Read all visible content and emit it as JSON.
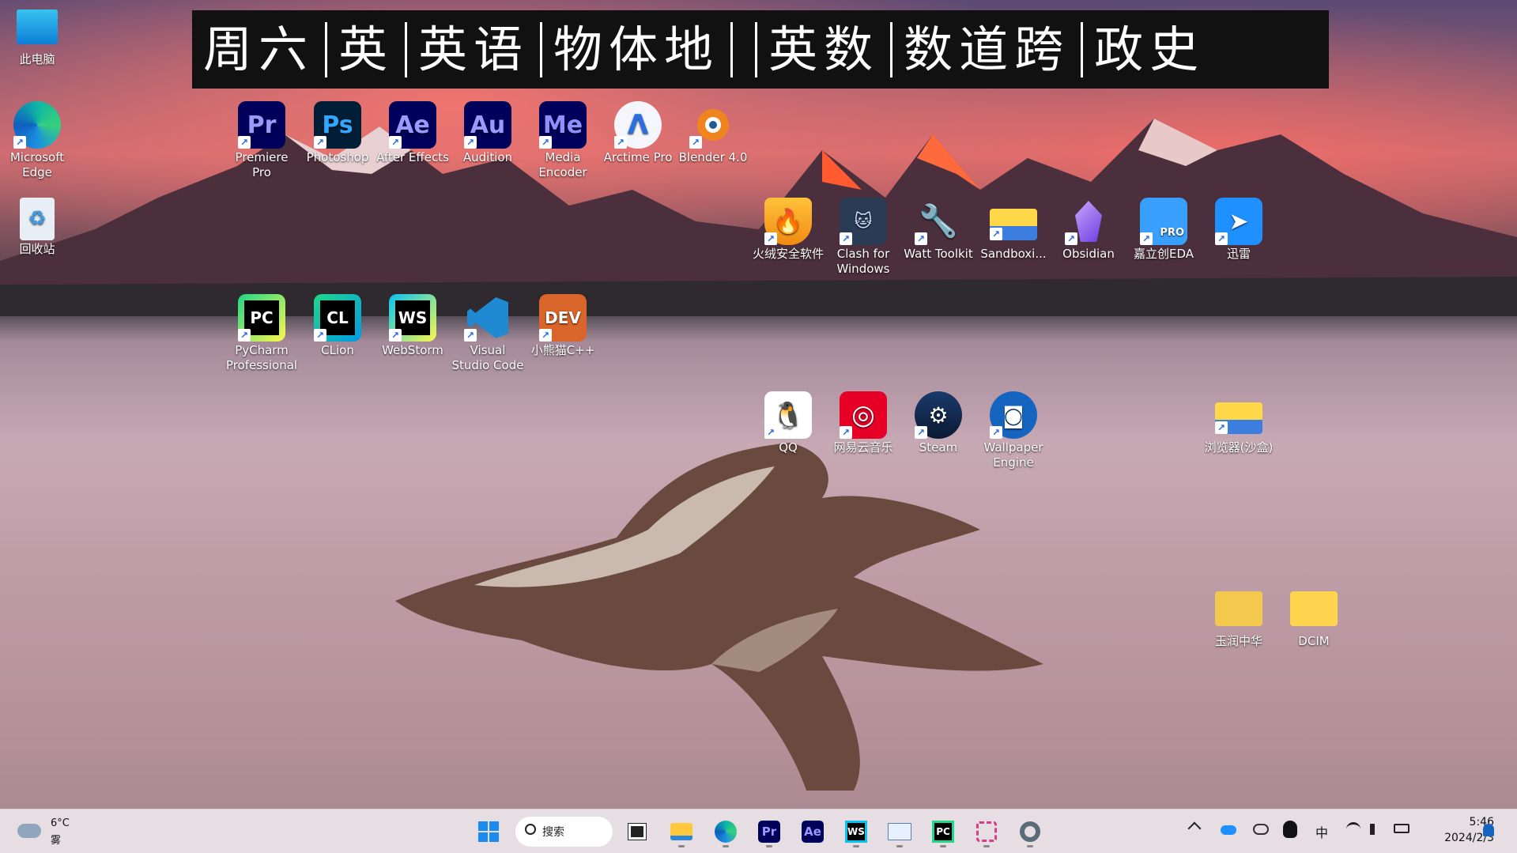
{
  "banner": {
    "segments": [
      "周六",
      "英",
      "英语",
      "物体地",
      "",
      "英数",
      "数道跨",
      "政史"
    ]
  },
  "desktop": {
    "this_pc": "此电脑",
    "edge": "Microsoft Edge",
    "recycle": "回收站",
    "premiere": "Premiere Pro",
    "photoshop": "Photoshop",
    "after_effects": "After Effects",
    "audition": "Audition",
    "media_encoder": "Media Encoder",
    "arctime": "Arctime Pro",
    "blender": "Blender 4.0",
    "huorong": "火绒安全软件",
    "clash": "Clash for Windows",
    "watt": "Watt Toolkit",
    "sandboxie": "Sandboxi...",
    "obsidian": "Obsidian",
    "jialichuang": "嘉立创EDA",
    "xunlei": "迅雷",
    "pycharm": "PyCharm Professional",
    "clion": "CLion",
    "webstorm": "WebStorm",
    "vscode": "Visual Studio Code",
    "devcpp": "小熊猫C++",
    "qq": "QQ",
    "netease": "网易云音乐",
    "steam": "Steam",
    "wallpaper": "Wallpaper Engine",
    "sandbox_browser": "浏览器(沙盒)",
    "yurun": "玉润中华",
    "dcim": "DCIM"
  },
  "icon_text": {
    "pr": "Pr",
    "ps": "Ps",
    "ae": "Ae",
    "au": "Au",
    "me": "Me",
    "pc": "PC",
    "cl": "CL",
    "ws": "WS",
    "dev": "DEV",
    "pro": "PRO"
  },
  "taskbar": {
    "weather_temp": "6°C",
    "weather_desc": "雾",
    "search_label": "搜索",
    "ime": "中",
    "time": "5:46",
    "date": "2024/2/3"
  },
  "colors": {
    "adobe_bg": "#00005b",
    "pr": "#9999ff",
    "ps": "#31a8ff",
    "ae": "#9999ff",
    "au": "#00e4bb",
    "me": "#8f90ff",
    "banner_bg": "#111111"
  }
}
